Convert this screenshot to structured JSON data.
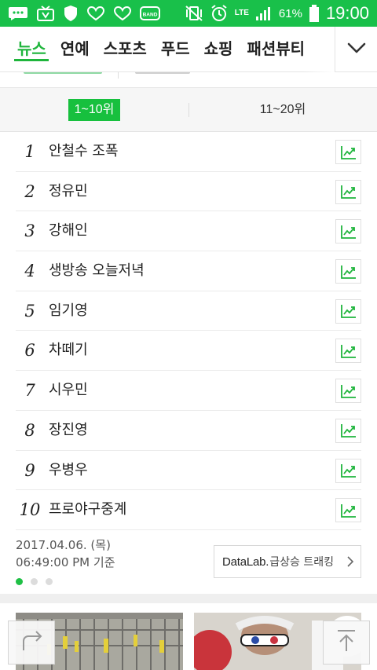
{
  "status_bar": {
    "network": "LTE",
    "battery_percent": "61%",
    "time": "19:00",
    "left_icons": [
      "chat-icon",
      "tv-icon",
      "shield-icon",
      "heart-icon",
      "heart-icon",
      "band-icon"
    ],
    "band_label": "BAND"
  },
  "nav": {
    "tabs": [
      {
        "label": "뉴스",
        "active": true
      },
      {
        "label": "연예",
        "active": false
      },
      {
        "label": "스포츠",
        "active": false
      },
      {
        "label": "푸드",
        "active": false
      },
      {
        "label": "쇼핑",
        "active": false
      },
      {
        "label": "패션뷰티",
        "active": false
      }
    ],
    "more_icon": "chevron-down-icon"
  },
  "range_tabs": [
    {
      "label": "1~10위",
      "active": true
    },
    {
      "label": "11~20위",
      "active": false
    }
  ],
  "ranking": [
    {
      "rank": "1",
      "keyword": "안철수 조폭"
    },
    {
      "rank": "2",
      "keyword": "정유민"
    },
    {
      "rank": "3",
      "keyword": "강해인"
    },
    {
      "rank": "4",
      "keyword": "생방송 오늘저녁"
    },
    {
      "rank": "5",
      "keyword": "임기영"
    },
    {
      "rank": "6",
      "keyword": "차떼기"
    },
    {
      "rank": "7",
      "keyword": "시우민"
    },
    {
      "rank": "8",
      "keyword": "장진영"
    },
    {
      "rank": "9",
      "keyword": "우병우"
    },
    {
      "rank": "10",
      "keyword": "프로야구중계"
    }
  ],
  "info": {
    "date": "2017.04.06. (목)",
    "time": "06:49:00 PM 기준",
    "datalab_brand": "DataLab.",
    "datalab_label": "급상승 트래킹",
    "page_count": 3,
    "current_page": 1
  },
  "colors": {
    "brand_green": "#19c04a",
    "accent_green": "#1fb53c"
  }
}
